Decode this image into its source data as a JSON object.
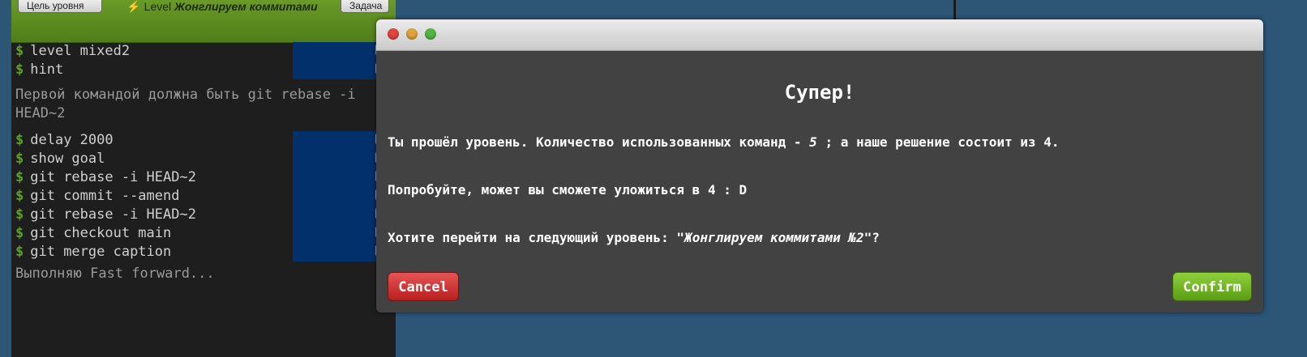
{
  "header": {
    "goal_button": "Цель уровня",
    "task_button": "Задача",
    "title_prefix": "⚡ Level ",
    "title_level": "Жонглируем коммитами"
  },
  "terminal": {
    "prompt": "$",
    "commands_group1": [
      "level mixed2",
      "hint"
    ],
    "hint_text": "Первой командой должна быть git rebase -i HEAD~2",
    "commands_group2": [
      "delay 2000",
      "show goal",
      "git rebase -i HEAD~2",
      "git commit --amend",
      "git rebase -i HEAD~2",
      "git checkout main",
      "git merge caption"
    ],
    "status_text": "Выполняю Fast forward..."
  },
  "modal": {
    "title": "Супер!",
    "line1_a": "Ты прошёл уровень. Количество использованных команд - ",
    "line1_count": "5",
    "line1_b": " ; а наше решение состоит из 4.",
    "line2": "Попробуйте, может вы сможете уложиться в 4 : D",
    "line3_a": "Хотите перейти на следующий уровень: ",
    "line3_level": "\"Жонглируем коммитами №2\"",
    "line3_b": "?",
    "cancel_label": "Cancel",
    "confirm_label": "Confirm"
  },
  "colors": {
    "background": "#2c5576",
    "modal_bg": "#424242",
    "cancel": "#cc3333",
    "confirm": "#6fb224",
    "header_green": "#5f8e22"
  }
}
